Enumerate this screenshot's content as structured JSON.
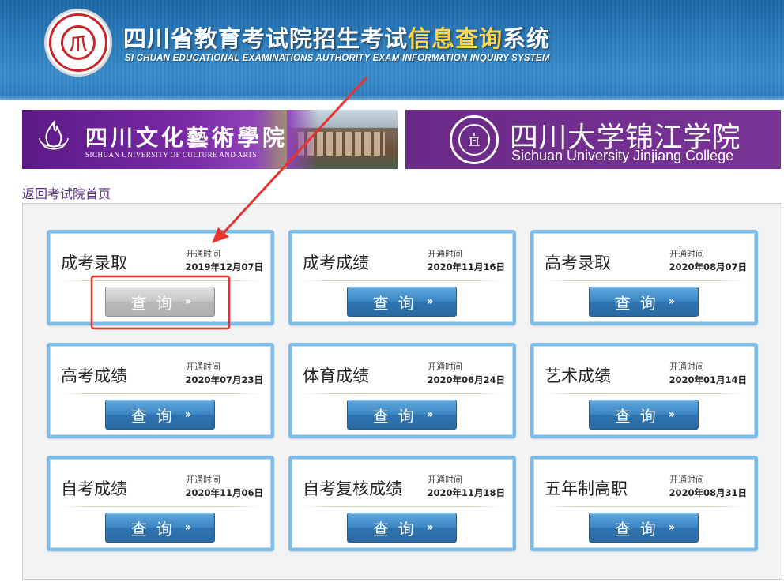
{
  "header": {
    "title_part1": "四川省教育考试院招生考试",
    "title_highlight": "信息查询",
    "title_part2": "系统",
    "subtitle": "SI CHUAN EDUCATIONAL EXAMINATIONS AUTHORITY EXAM INFORMATION INQUIRY SYSTEM",
    "logo_glyph": "爪"
  },
  "banners": {
    "left": {
      "cn": "四川文化藝術學院",
      "en": "SICHUAN UNIVERSITY OF CULTURE AND ARTS"
    },
    "right": {
      "cn": "四川大学锦江学院",
      "en": "Sichuan University Jinjiang College"
    }
  },
  "back_link": "返回考试院首页",
  "time_label": "开通时间",
  "button": {
    "label": "查询",
    "arrow": "››"
  },
  "cards": [
    {
      "name": "成考录取",
      "time": "2019年12月07日",
      "state": "disabled"
    },
    {
      "name": "成考成绩",
      "time": "2020年11月16日",
      "state": "active"
    },
    {
      "name": "高考录取",
      "time": "2020年08月07日",
      "state": "active"
    },
    {
      "name": "高考成绩",
      "time": "2020年07月23日",
      "state": "active"
    },
    {
      "name": "体育成绩",
      "time": "2020年06月24日",
      "state": "active"
    },
    {
      "name": "艺术成绩",
      "time": "2020年01月14日",
      "state": "active"
    },
    {
      "name": "自考成绩",
      "time": "2020年11月06日",
      "state": "active"
    },
    {
      "name": "自考复核成绩",
      "time": "2020年11月18日",
      "state": "active"
    },
    {
      "name": "五年制高职",
      "time": "2020年08月31日",
      "state": "active"
    }
  ],
  "colors": {
    "header_blue": "#2e7fbf",
    "title_highlight": "#ffd54a",
    "banner_purple": "#7a2aa5",
    "card_border": "#7dbbe8",
    "button_blue": "#3c86c4",
    "button_disabled": "#c7c7c7",
    "annotation_red": "#e8342f"
  }
}
